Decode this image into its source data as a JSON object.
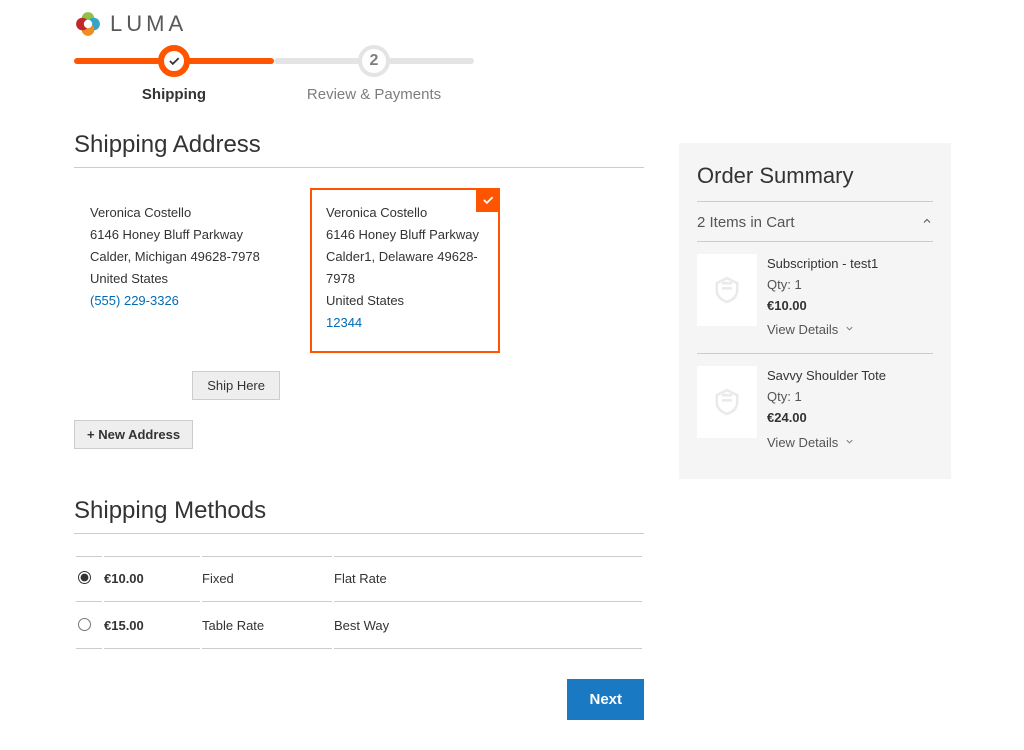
{
  "brand": {
    "name": "LUMA"
  },
  "steps": {
    "shipping": "Shipping",
    "review": "Review & Payments",
    "review_num": "2"
  },
  "sections": {
    "shipping_address": "Shipping Address",
    "shipping_methods": "Shipping Methods"
  },
  "addresses": [
    {
      "name": "Veronica Costello",
      "street": "6146 Honey Bluff Parkway",
      "city_line": "Calder, Michigan 49628-7978",
      "country": "United States",
      "phone": "(555) 229-3326",
      "selected": false
    },
    {
      "name": "Veronica Costello",
      "street": "6146 Honey Bluff Parkway",
      "city_line": "Calder1, Delaware 49628-7978",
      "country": "United States",
      "phone": "12344",
      "selected": true
    }
  ],
  "buttons": {
    "ship_here": "Ship Here",
    "new_address": "+ New Address",
    "next": "Next",
    "view_details": "View Details"
  },
  "shipping_methods": [
    {
      "price": "€10.00",
      "method": "Fixed",
      "carrier": "Flat Rate",
      "selected": true
    },
    {
      "price": "€15.00",
      "method": "Table Rate",
      "carrier": "Best Way",
      "selected": false
    }
  ],
  "summary": {
    "title": "Order Summary",
    "count_label": "2 Items in Cart",
    "items": [
      {
        "name": "Subscription - test1",
        "qty_label": "Qty: 1",
        "price": "€10.00"
      },
      {
        "name": "Savvy Shoulder Tote",
        "qty_label": "Qty: 1",
        "price": "€24.00"
      }
    ]
  }
}
